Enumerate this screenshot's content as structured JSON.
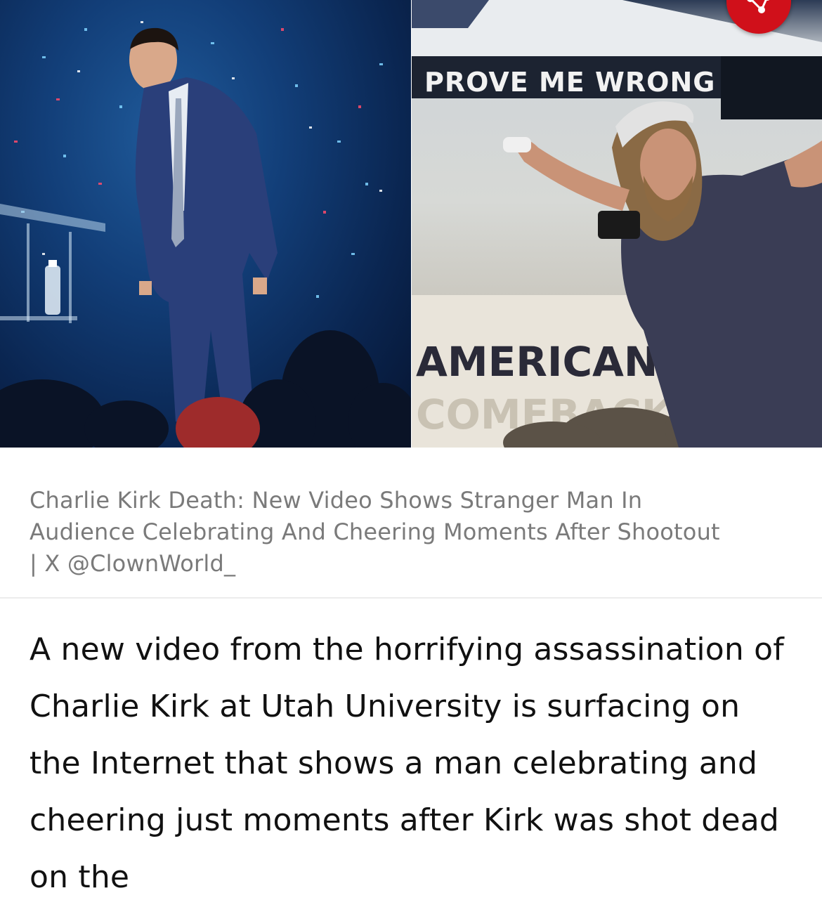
{
  "hero": {
    "left_sign_text": "",
    "right_banner_top": "PROVE ME WRONG",
    "right_banner_bottom_line1": "AMERICAN",
    "right_banner_bottom_line2": "COMEBACK"
  },
  "share": {
    "icon": "share-icon",
    "color": "#d0101a"
  },
  "caption": {
    "text": "Charlie Kirk Death: New Video Shows Stranger Man In Audience Celebrating And Cheering Moments After Shootout | X @ClownWorld_"
  },
  "article": {
    "paragraph": "A new video from the horrifying assassination of Charlie Kirk at Utah University is surfacing on the Internet that shows a man celebrating and cheering just moments after Kirk was shot dead on the"
  }
}
